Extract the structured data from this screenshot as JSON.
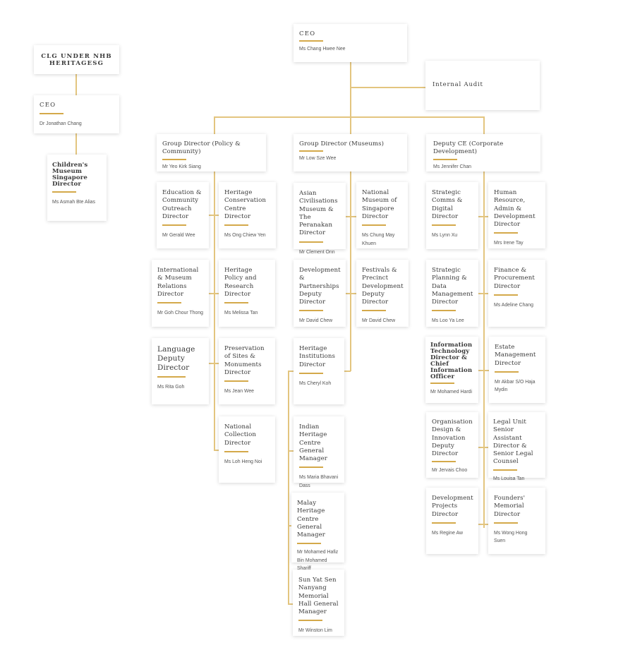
{
  "colors": {
    "accent": "#d4a94a",
    "connector": "#e3c57f",
    "text": "#3a3a3a"
  },
  "clg": {
    "header": "CLG UNDER NHB HERITAGESG",
    "ceo": {
      "title": "CEO",
      "name": "Dr Jonathan Chang"
    },
    "childrens_museum": {
      "title": "Children's Museum Singapore Director",
      "name": "Ms Asmah Bte Alias"
    }
  },
  "nhb": {
    "ceo": {
      "title": "CEO",
      "name": "Ms Chang Hwee Nee"
    },
    "internal_audit": {
      "title": "Internal Audit"
    },
    "groups": [
      {
        "title": "Group Director (Policy & Community)",
        "name": "Mr Yeo Kirk Siang",
        "units": [
          {
            "title": "Education & Community Outreach Director",
            "name": "Mr Gerald Wee"
          },
          {
            "title": "Heritage Conservation Centre Director",
            "name": "Ms Ong Chiew Yen"
          },
          {
            "title": "International & Museum Relations Director",
            "name": "Mr Goh Chour Thong"
          },
          {
            "title": "Heritage Policy and Research Director",
            "name": "Ms Melissa Tan"
          },
          {
            "title": "Language Deputy Director",
            "name": "Ms Rita Goh"
          },
          {
            "title": "Preservation of Sites & Monuments Director",
            "name": "Ms Jean Wee"
          },
          {
            "title": "National Collection Director",
            "name": "Ms Loh Heng Noi"
          }
        ]
      },
      {
        "title": "Group Director (Museums)",
        "name": "Mr Low Sze Wee",
        "units": [
          {
            "title": "Asian Civilisations Museum & The Peranakan Director",
            "name": "Mr Clement Onn"
          },
          {
            "title": "National Museum of Singapore Director",
            "name": "Ms Chung May Khuen"
          },
          {
            "title": "Development & Partnerships Deputy Director",
            "name": "Mr David Chew"
          },
          {
            "title": "Festivals & Precinct Development Deputy Director",
            "name": "Mr David Chew"
          },
          {
            "title": "Heritage Institutions Director",
            "name": "Ms Cheryl Koh"
          },
          {
            "title": "Indian Heritage Centre General Manager",
            "name": "Ms Maria Bhavani Dass"
          },
          {
            "title": "Malay Heritage Centre General Manager",
            "name": "Mr Mohamed Hafiz Bin Mohamed Shariff"
          },
          {
            "title": "Sun Yat Sen Nanyang Memorial Hall General Manager",
            "name": "Mr Winston Lim"
          }
        ]
      },
      {
        "title": "Deputy CE (Corporate Development)",
        "name": "Ms Jennifer Chan",
        "units": [
          {
            "title": "Strategic Comms & Digital Director",
            "name": "Ms Lynn Xu"
          },
          {
            "title": "Human Resource, Admin & Development Director",
            "name": "Mrs Irene Tay"
          },
          {
            "title": "Strategic Planning & Data Management Director",
            "name": "Ms Loo Ya Lee"
          },
          {
            "title": "Finance & Procurement Director",
            "name": "Ms Adeline Chang"
          },
          {
            "title": "Information Technology Director & Chief Information Officer",
            "name": "Mr Mohamed Hardi"
          },
          {
            "title": "Estate Management Director",
            "name": "Mr Akbar S/O Haja Mydin"
          },
          {
            "title": "Organisation Design & Innovation Deputy Director",
            "name": "Mr Jervais Choo"
          },
          {
            "title": "Legal Unit Senior Assistant Director & Senior Legal Counsel",
            "name": "Ms Louisa Tan"
          },
          {
            "title": "Development Projects Director",
            "name": "Ms Regine Aw"
          },
          {
            "title": "Founders' Memorial Director",
            "name": "Ms Wong Hong Suen"
          }
        ]
      }
    ]
  }
}
